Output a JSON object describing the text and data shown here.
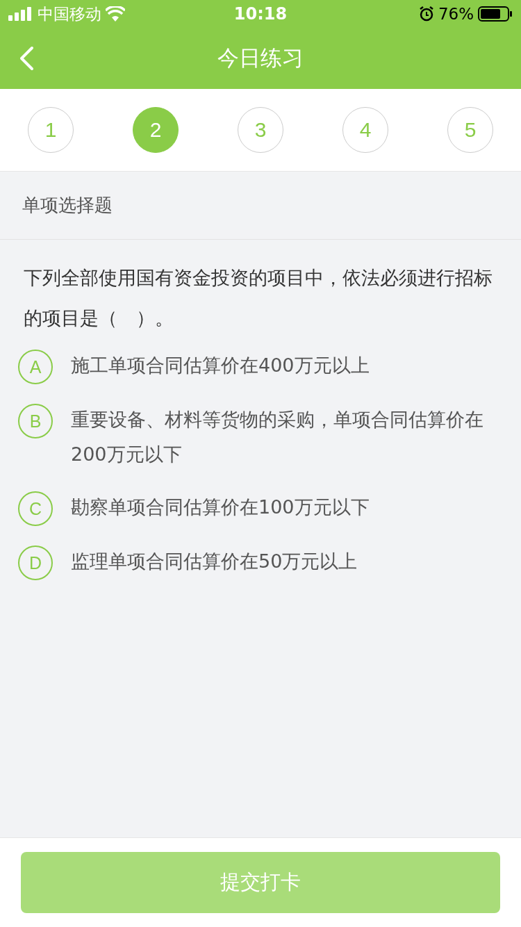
{
  "status_bar": {
    "carrier": "中国移动",
    "time": "10:18",
    "battery": "76%"
  },
  "nav": {
    "title": "今日练习"
  },
  "steps": [
    {
      "label": "1",
      "selected": false
    },
    {
      "label": "2",
      "selected": true
    },
    {
      "label": "3",
      "selected": false
    },
    {
      "label": "4",
      "selected": false
    },
    {
      "label": "5",
      "selected": false
    }
  ],
  "section": {
    "title": "单项选择题"
  },
  "question": {
    "text": "下列全部使用国有资金投资的项目中，依法必须进行招标的项目是（　）。",
    "options": [
      {
        "letter": "A",
        "text": "施工单项合同估算价在400万元以上",
        "selected": false
      },
      {
        "letter": "B",
        "text": "重要设备、材料等货物的采购，单项合同估算价在200万元以下",
        "selected": false
      },
      {
        "letter": "C",
        "text": "勘察单项合同估算价在100万元以下",
        "selected": false
      },
      {
        "letter": "D",
        "text": "监理单项合同估算价在50万元以上",
        "selected": false
      }
    ]
  },
  "submit": {
    "label": "提交打卡",
    "disabled": true
  }
}
